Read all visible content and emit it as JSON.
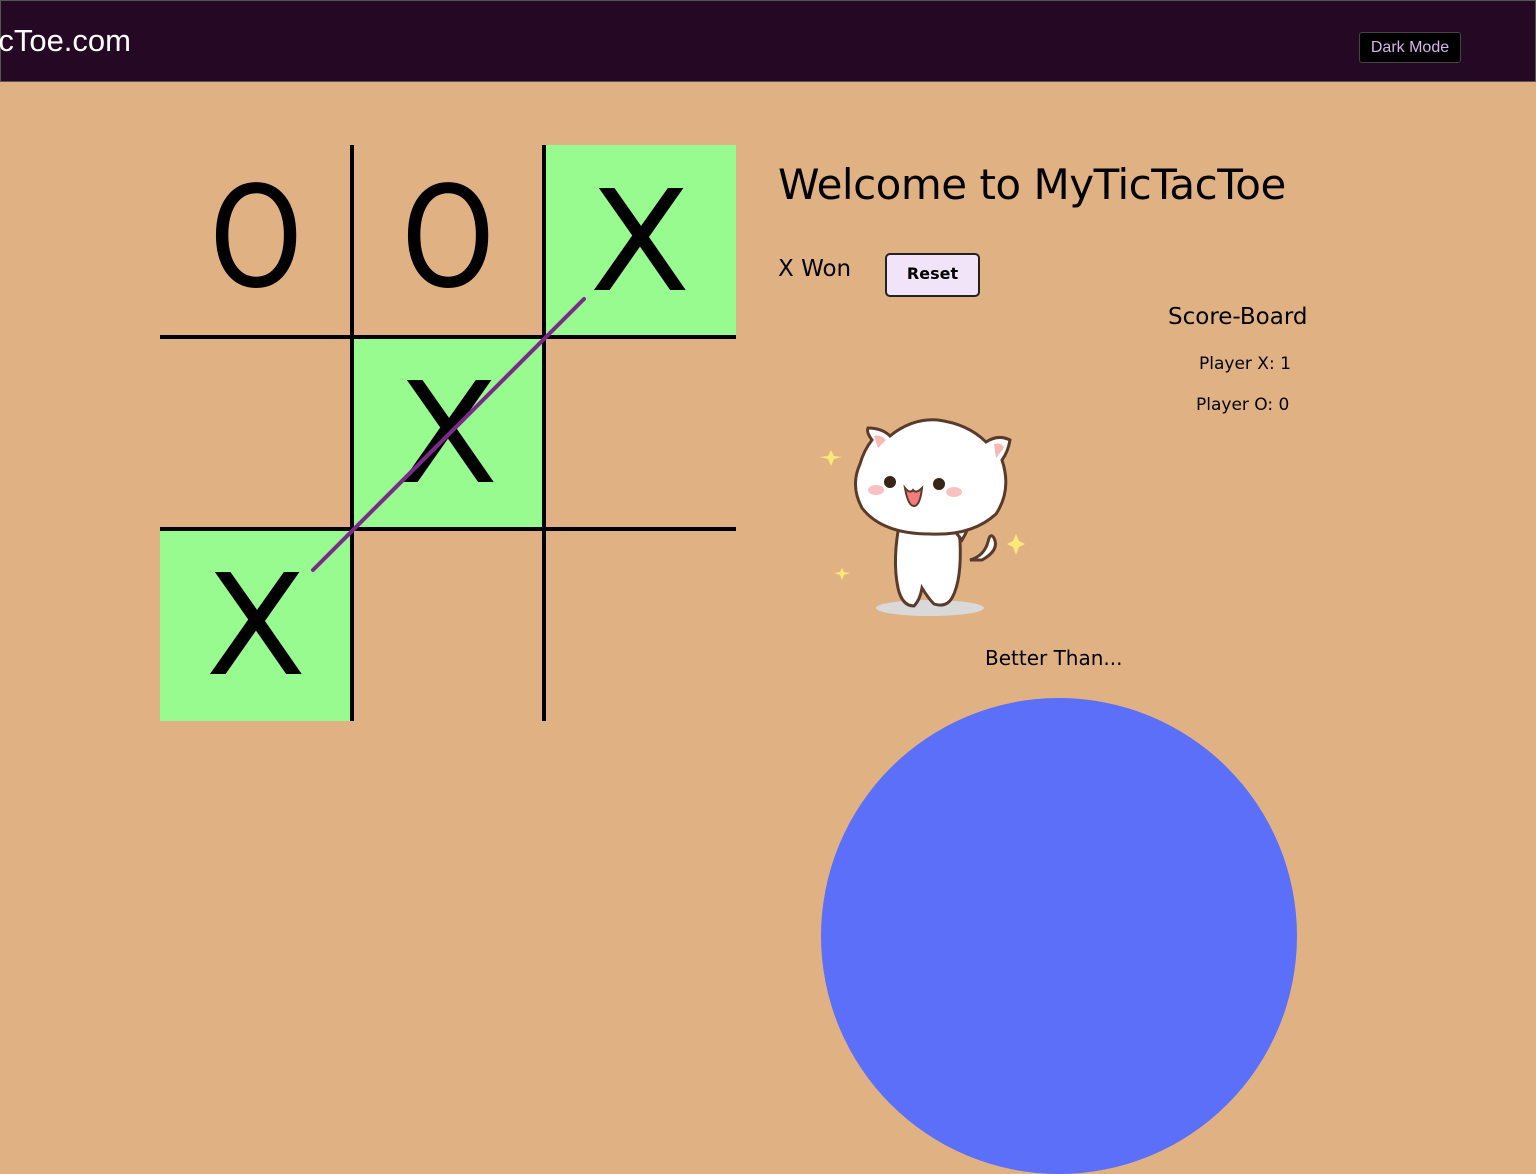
{
  "navbar": {
    "brand": "MyTicTacToe.com",
    "dark_mode_label": "Dark Mode"
  },
  "board": {
    "cells": [
      "O",
      "O",
      "X",
      "",
      "X",
      "",
      "X",
      "",
      ""
    ],
    "winning_cells": [
      2,
      4,
      6
    ]
  },
  "main": {
    "title": "Welcome to MyTicTacToe",
    "status": "X Won",
    "reset_label": "Reset"
  },
  "scoreboard": {
    "title": "Score-Board",
    "player_x": "Player X: 1",
    "player_o": "Player O: 0"
  },
  "footer": {
    "tagline": "Better Than..."
  },
  "colors": {
    "background": "#e0b283",
    "navbar": "#250823",
    "win_cell": "#98fb8f",
    "win_line": "#7b2a8a",
    "blob": "#5b6ff8"
  }
}
